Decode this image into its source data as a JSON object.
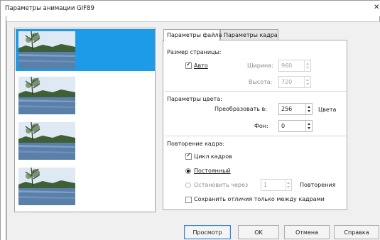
{
  "window": {
    "title": "Параметры анимации GIF89",
    "close_glyph": "✕"
  },
  "frames": {
    "count": 4,
    "selected_index": 0,
    "thumbnail": "lake-landscape-image"
  },
  "tabs": [
    {
      "label": "Параметры файла",
      "active": true
    },
    {
      "label": "Параметры кадра",
      "active": false
    }
  ],
  "page_size": {
    "heading": "Размер страницы:",
    "auto_label": "Авто",
    "auto_checked": true,
    "width_label": "Ширина:",
    "width_value": "960",
    "height_label": "Высота:",
    "height_value": "720"
  },
  "color_params": {
    "heading": "Параметры цвета:",
    "convert_label": "Преобразовать в:",
    "convert_value": "256",
    "convert_unit": "Цвета",
    "background_label": "Фон:",
    "background_value": "0"
  },
  "frame_repeat": {
    "heading": "Повторение кадра:",
    "loop_label": "Цикл кадров",
    "loop_checked": true,
    "constant_label": "Постоянный",
    "stop_after_label": "Остановить через",
    "stop_after_value": "1",
    "repeats_label": "Повторения",
    "save_diff_label": "Сохранить отличия только между кадрами"
  },
  "buttons": {
    "preview": "Просмотр",
    "ok": "OK",
    "cancel": "Отмена",
    "help": "Справка"
  },
  "colors": {
    "selection": "#1e9be8",
    "dialog_bg": "#f0f0f0",
    "primary_border": "#3c7fd6"
  }
}
